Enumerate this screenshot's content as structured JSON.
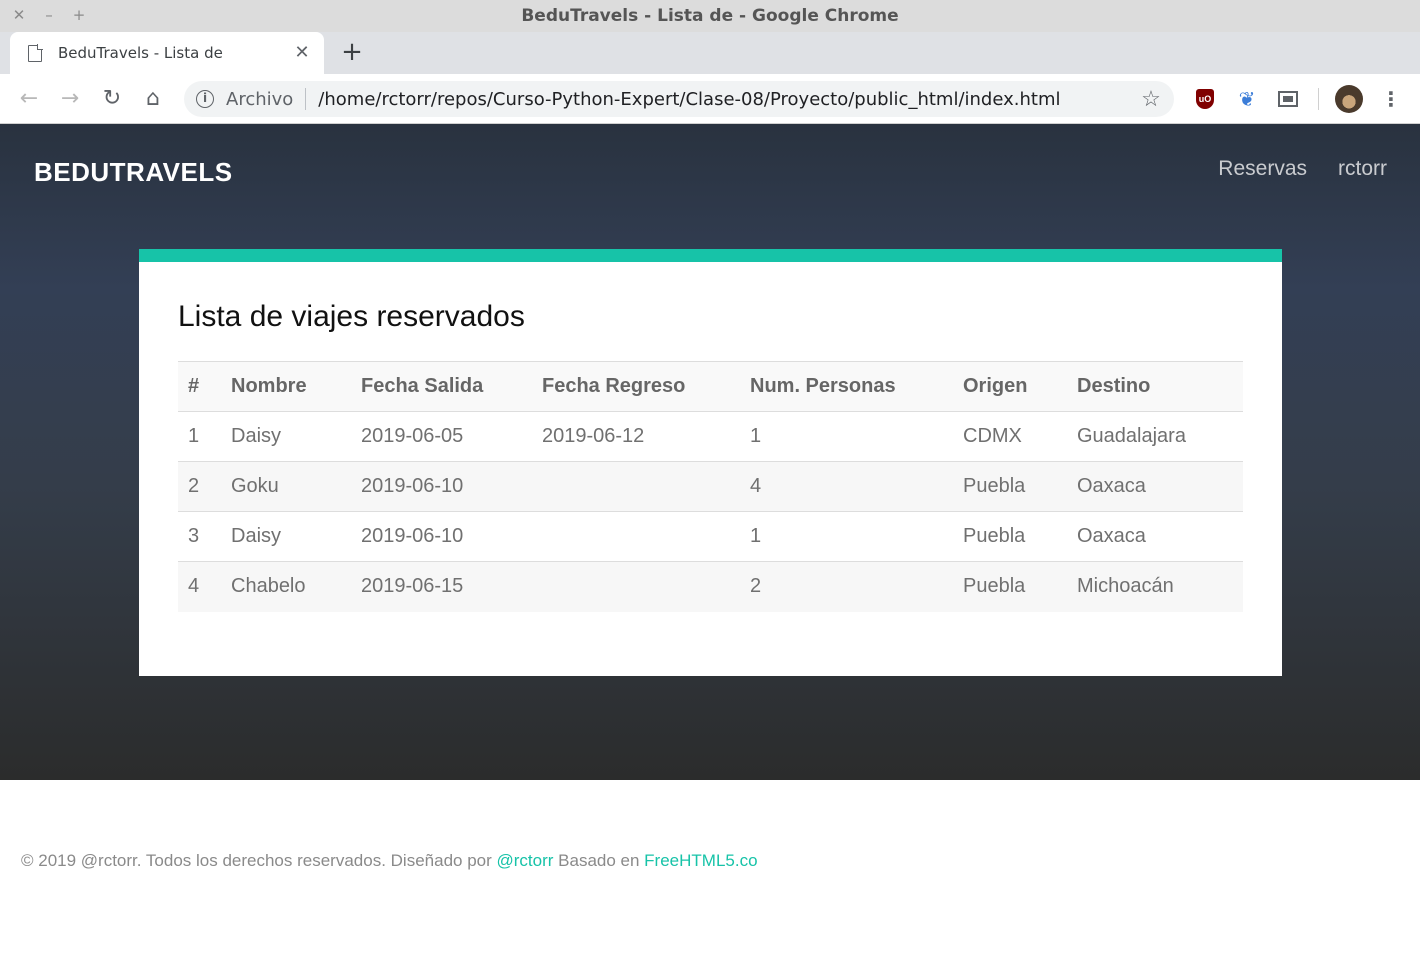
{
  "window": {
    "title": "BeduTravels - Lista de - Google Chrome",
    "controls": {
      "close": "✕",
      "minimize": "–",
      "maximize": "+"
    }
  },
  "tab": {
    "title": "BeduTravels - Lista de",
    "close": "✕",
    "new_tab": "+"
  },
  "toolbar": {
    "back": "←",
    "forward": "→",
    "reload": "↻",
    "home": "⌂",
    "info": "i",
    "origin_chip": "Archivo",
    "url": "/home/rctorr/repos/Curso-Python-Expert/Clase-08/Proyecto/public_html/index.html",
    "star": "☆",
    "ext_ublock": "uO",
    "ext_feather": "❦",
    "menu": "⋮"
  },
  "site": {
    "brand": "BEDUTRAVELS",
    "nav": [
      "Reservas",
      "rctorr"
    ]
  },
  "card": {
    "title": "Lista de viajes reservados",
    "accent_color": "#17c3a8"
  },
  "table": {
    "headers": [
      "#",
      "Nombre",
      "Fecha Salida",
      "Fecha Regreso",
      "Num. Personas",
      "Origen",
      "Destino"
    ],
    "rows": [
      [
        "1",
        "Daisy",
        "2019-06-05",
        "2019-06-12",
        "1",
        "CDMX",
        "Guadalajara"
      ],
      [
        "2",
        "Goku",
        "2019-06-10",
        "",
        "4",
        "Puebla",
        "Oaxaca"
      ],
      [
        "3",
        "Daisy",
        "2019-06-10",
        "",
        "1",
        "Puebla",
        "Oaxaca"
      ],
      [
        "4",
        "Chabelo",
        "2019-06-15",
        "",
        "2",
        "Puebla",
        "Michoacán"
      ]
    ]
  },
  "footer": {
    "text1": "© 2019 @rctorr. Todos los derechos reservados. Diseñado por ",
    "link1": "@rctorr",
    "text2": " Basado en ",
    "link2": "FreeHTML5.co"
  }
}
